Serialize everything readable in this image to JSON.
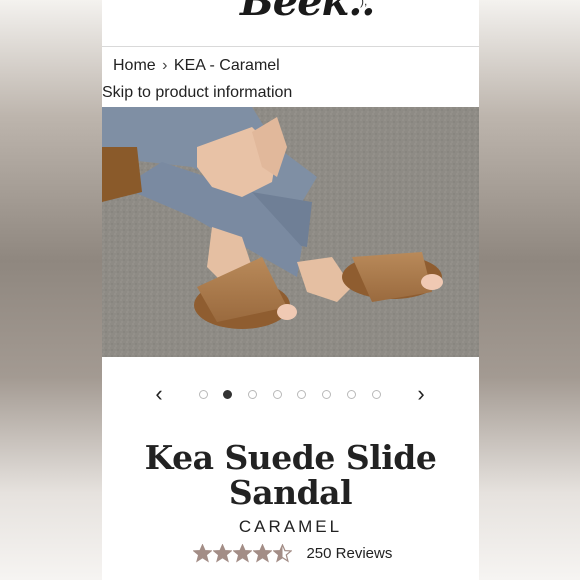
{
  "header": {
    "logo_text": "Beek..",
    "logo_extra": "),"
  },
  "breadcrumb": {
    "home": "Home",
    "separator": "›",
    "current": "KEA - Caramel"
  },
  "skip_link": "Skip to product information",
  "gallery": {
    "prev_icon": "chevron-left-icon",
    "next_icon": "chevron-right-icon",
    "prev_glyph": "‹",
    "next_glyph": "›",
    "total_slides": 8,
    "active_slide": 2
  },
  "product": {
    "title": "Kea Suede Slide Sandal",
    "color": "CARAMEL",
    "rating": 4.5,
    "rating_max": 5,
    "reviews": "250 Reviews",
    "star_color": "#a38d86"
  }
}
